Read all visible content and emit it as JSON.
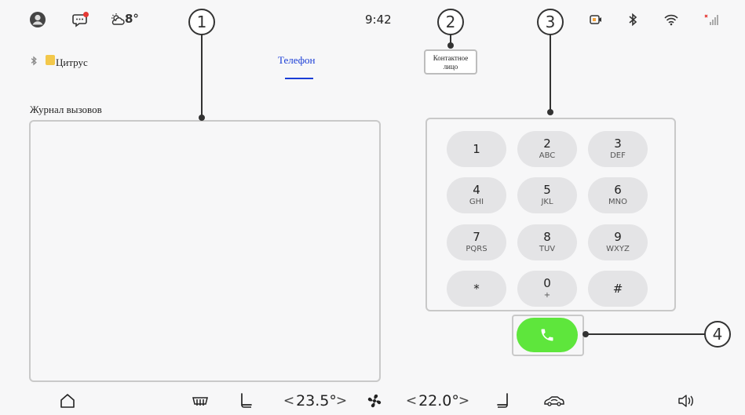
{
  "status_bar": {
    "weather_temp": "8°",
    "clock": "9:42",
    "icons": [
      "avatar-icon",
      "message-icon",
      "weather-icon",
      "camera-record-icon",
      "bluetooth-icon",
      "wifi-icon",
      "signal-icon"
    ],
    "notification_color": "#e53935"
  },
  "device": {
    "name": "Цитрус"
  },
  "tabs": {
    "active_label": "Телефон",
    "active_color": "#1a3dd6"
  },
  "contact_button": {
    "label_line1": "Контактное",
    "label_line2": "лицо"
  },
  "call_log": {
    "title": "Журнал вызовов"
  },
  "keypad": {
    "keys": [
      {
        "digit": "1",
        "letters": ""
      },
      {
        "digit": "2",
        "letters": "ABC"
      },
      {
        "digit": "3",
        "letters": "DEF"
      },
      {
        "digit": "4",
        "letters": "GHI"
      },
      {
        "digit": "5",
        "letters": "JKL"
      },
      {
        "digit": "6",
        "letters": "MNO"
      },
      {
        "digit": "7",
        "letters": "PQRS"
      },
      {
        "digit": "8",
        "letters": "TUV"
      },
      {
        "digit": "9",
        "letters": "WXYZ"
      },
      {
        "digit": "*",
        "letters": ""
      },
      {
        "digit": "0",
        "letters": "+"
      },
      {
        "digit": "#",
        "letters": ""
      }
    ],
    "call_color": "#5ee63c"
  },
  "callouts": [
    "1",
    "2",
    "3",
    "4"
  ],
  "climate": {
    "left_temp": "23.5°",
    "right_temp": "22.0°",
    "chevron_left": "<",
    "chevron_right": ">"
  }
}
